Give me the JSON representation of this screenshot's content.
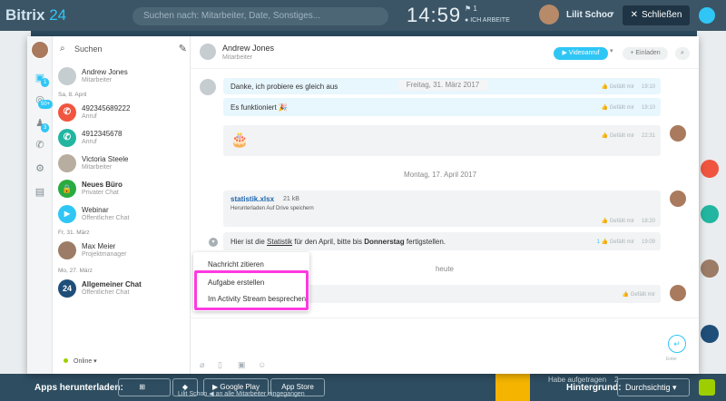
{
  "top": {
    "logo_prefix": "Bitrix",
    "logo_number": "24",
    "search_placeholder": "Suchen nach: Mitarbeiter, Date, Sonstiges...",
    "clock": "14:59",
    "flag": "1",
    "work_status": "ICH ARBEITE",
    "user": "Lilit Schoo",
    "close_label": "Schließen"
  },
  "sidebar": {
    "search_label": "Suchen",
    "items": [
      {
        "name": "Andrew Jones",
        "sub": "Mitarbeiter",
        "color": "#c6cdd1",
        "initial": ""
      },
      {
        "name": "492345689222",
        "sub": "Anruf",
        "color": "#f0553f",
        "initial": "✆"
      },
      {
        "name": "4912345678",
        "sub": "Anruf",
        "color": "#22b6a0",
        "initial": "✆"
      },
      {
        "name": "Victoria Steele",
        "sub": "Mitarbeiter",
        "color": "#b8aea0",
        "initial": ""
      },
      {
        "name": "Neues Büro",
        "sub": "Privater Chat",
        "color": "#29ab3f",
        "initial": "🔒"
      },
      {
        "name": "Webinar",
        "sub": "Öffentlicher Chat",
        "color": "#2fc6f6",
        "initial": "▶"
      },
      {
        "name": "Max Meier",
        "sub": "Projektmanager",
        "color": "#9c7c66",
        "initial": ""
      },
      {
        "name": "Allgemeiner Chat",
        "sub": "Öffentlicher Chat",
        "color": "#1f4e79",
        "initial": "24"
      }
    ],
    "date_separators": [
      "Sa, 8. April",
      "Fr, 31. März",
      "Mo, 27. März"
    ],
    "status": "Online"
  },
  "rail": {
    "badge1": "1",
    "badge2": "50+",
    "badge3": "3"
  },
  "chat": {
    "partner_name": "Andrew Jones",
    "partner_role": "Mitarbeiter",
    "video_label": "Videoanruf",
    "invite_label": "+ Einladen",
    "like_label": "Gefällt mir",
    "messages": {
      "m1_text": "Danke, ich probiere es gleich aus",
      "m1_date": "Freitag, 31. März 2017",
      "m1_time": "19:10",
      "m2_text": "Es funktioniert 🎉",
      "m2_time": "19:10",
      "m3_time": "22:31",
      "day2": "Montag, 17. April 2017",
      "file_name": "statistik.xlsx",
      "file_size": "21 kB",
      "file_links": "Herunterladen   Auf Drive speichern",
      "m4_time": "18:20",
      "m5_text_a": "Hier ist die ",
      "m5_text_b": "Statistik",
      "m5_text_c": " für den April, bitte bis ",
      "m5_text_d": "Donnerstag",
      "m5_text_e": " fertigstellen.",
      "m5_likes": "1",
      "m5_time": "19:09",
      "today": "heute"
    },
    "enter_label": "Enter"
  },
  "context_menu": {
    "items": [
      "Nachricht zitieren",
      "Aufgabe erstellen",
      "Im Activity Stream besprechen"
    ]
  },
  "bottom": {
    "apps_label": "Apps herunterladen:",
    "google_play": "Google Play",
    "app_store": "App Store",
    "background_label": "Hintergrund:",
    "background_value": "Durchsichtig",
    "task_label": "Habe aufgetragen",
    "task_count": "2",
    "footer_text": "Lilit Schoo ◀ an alle Mitarbeiter eingegangen"
  },
  "colors": {
    "accent": "#2fc6f6",
    "highlight": "#ff3ae0"
  }
}
